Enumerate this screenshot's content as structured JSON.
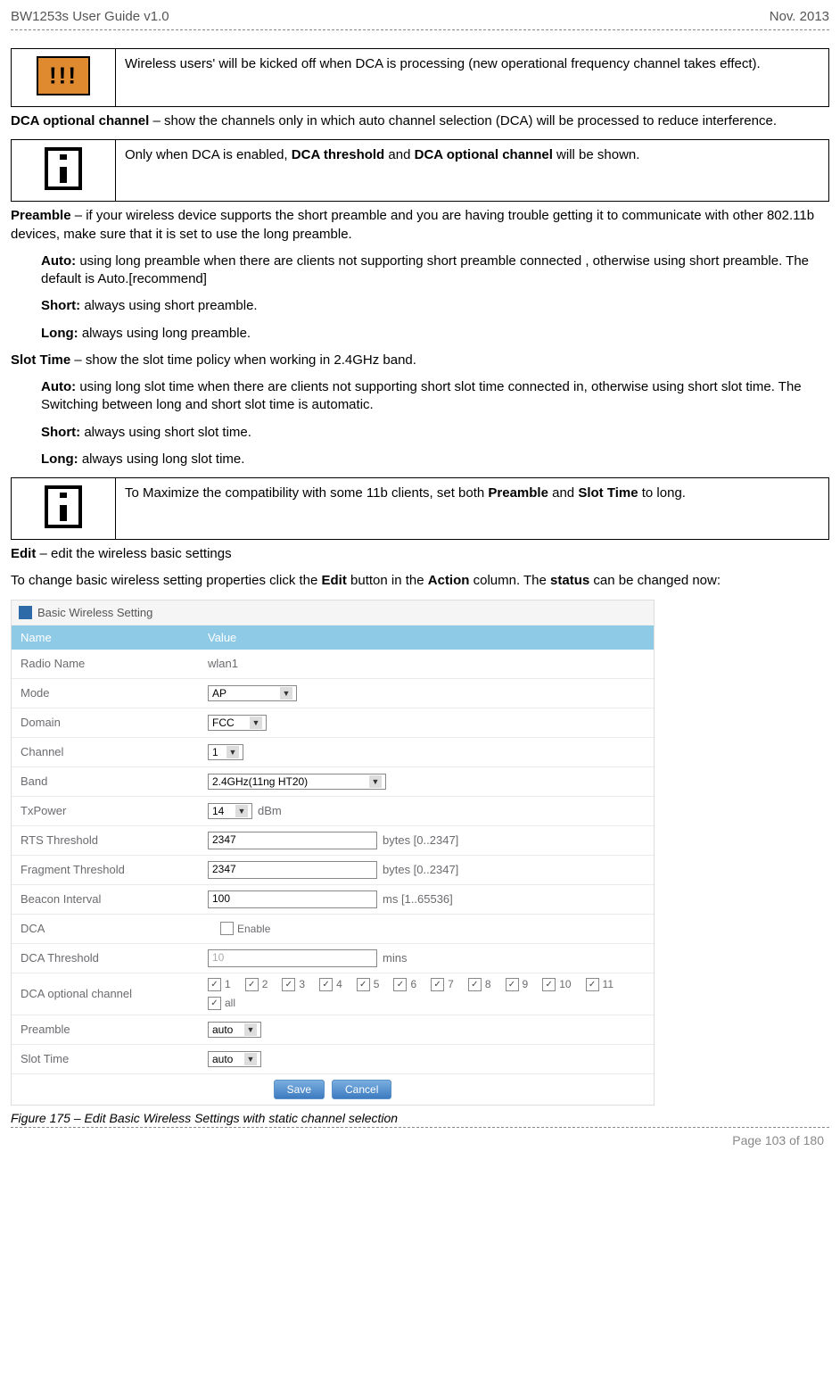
{
  "header": {
    "left": "BW1253s User Guide v1.0",
    "right": "Nov.  2013"
  },
  "notes": {
    "warn1": "Wireless users' will be kicked off when DCA is processing (new operational frequency channel takes effect).",
    "info1_prefix": "Only when DCA is enabled, ",
    "info1_b1": "DCA threshold",
    "info1_mid": " and ",
    "info1_b2": "DCA optional channel",
    "info1_suffix": " will be shown.",
    "info2_prefix": "To Maximize the compatibility with some 11b clients, set both ",
    "info2_b1": "Preamble",
    "info2_mid": " and ",
    "info2_b2": "Slot Time",
    "info2_suffix": " to long."
  },
  "paras": {
    "dca_opt_b": "DCA optional channel",
    "dca_opt_rest": " – show the channels only in which auto channel selection (DCA) will be processed to reduce interference.",
    "preamble_b": "Preamble",
    "preamble_rest": " – if your wireless device supports the short preamble and you are having trouble getting it to communicate with other 802.11b devices, make sure that it is set to use the long preamble.",
    "p_auto_b": "Auto:",
    "p_auto_rest": " using long preamble when there are clients not supporting short preamble connected , otherwise using short preamble. The default is Auto.[recommend]",
    "p_short_b": "Short:",
    "p_short_rest": " always using short preamble.",
    "p_long_b": "Long:",
    "p_long_rest": " always using long preamble.",
    "slot_b": "Slot Time",
    "slot_rest": " – show the slot time policy when working in 2.4GHz band.",
    "s_auto_b": "Auto:",
    "s_auto_rest": " using long slot time when there are clients not supporting short slot time connected in, otherwise using short slot time. The Switching between long and short slot time is automatic.",
    "s_short_b": "Short:",
    "s_short_rest": " always using short slot time.",
    "s_long_b": "Long:",
    "s_long_rest": " always using long slot time.",
    "edit_b": "Edit",
    "edit_rest": " – edit the wireless basic settings",
    "change_prefix": "To change basic wireless setting properties click the ",
    "change_b1": "Edit",
    "change_mid1": " button in the ",
    "change_b2": "Action",
    "change_mid2": " column. The ",
    "change_b3": "status",
    "change_suffix": " can be changed now:"
  },
  "form": {
    "title": "Basic Wireless Setting",
    "col_name": "Name",
    "col_value": "Value",
    "rows": {
      "radio_name_l": "Radio Name",
      "radio_name_v": "wlan1",
      "mode_l": "Mode",
      "mode_v": "AP",
      "domain_l": "Domain",
      "domain_v": "FCC",
      "channel_l": "Channel",
      "channel_v": "1",
      "band_l": "Band",
      "band_v": "2.4GHz(11ng HT20)",
      "txpower_l": "TxPower",
      "txpower_v": "14",
      "txpower_unit": "dBm",
      "rts_l": "RTS Threshold",
      "rts_v": "2347",
      "rts_hint": "bytes [0..2347]",
      "frag_l": "Fragment Threshold",
      "frag_v": "2347",
      "frag_hint": "bytes [0..2347]",
      "beacon_l": "Beacon Interval",
      "beacon_v": "100",
      "beacon_hint": "ms [1..65536]",
      "dca_l": "DCA",
      "dca_enable": "Enable",
      "dca_th_l": "DCA Threshold",
      "dca_th_v": "10",
      "dca_th_hint": "mins",
      "dca_opt_l": "DCA optional channel",
      "preamble_l": "Preamble",
      "preamble_v": "auto",
      "slot_l": "Slot Time",
      "slot_v": "auto"
    },
    "channels": [
      "1",
      "2",
      "3",
      "4",
      "5",
      "6",
      "7",
      "8",
      "9",
      "10",
      "11",
      "all"
    ],
    "save": "Save",
    "cancel": "Cancel"
  },
  "caption": "Figure 175 – Edit Basic Wireless Settings with static channel selection",
  "footer": "Page 103 of 180"
}
